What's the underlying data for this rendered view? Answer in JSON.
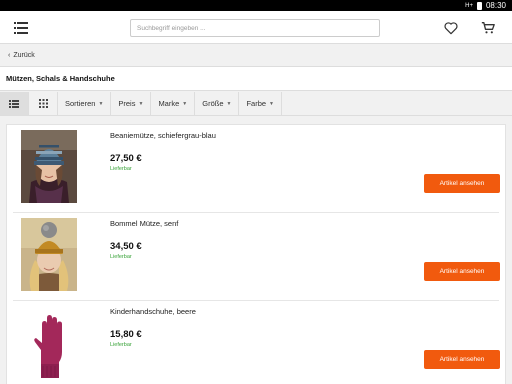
{
  "status_bar": {
    "signal": "H+",
    "time": "08:30"
  },
  "header": {
    "search_placeholder": "Suchbegriff eingeben ...",
    "icons": [
      "menu-icon",
      "heart-icon",
      "cart-icon"
    ]
  },
  "back": {
    "label": "Zurück"
  },
  "category": {
    "title": "Mützen, Schals & Handschuhe"
  },
  "filters": {
    "view_modes": [
      "list-view-icon",
      "grid-view-icon"
    ],
    "items": [
      {
        "label": "Sortieren"
      },
      {
        "label": "Preis"
      },
      {
        "label": "Marke"
      },
      {
        "label": "Größe"
      },
      {
        "label": "Farbe"
      }
    ]
  },
  "products": [
    {
      "name": "Beaniemütze, schiefergrau-blau",
      "price": "27,50 €",
      "availability": "Lieferbar",
      "button": "Artikel ansehen",
      "image": "person-wearing-striped-beanie"
    },
    {
      "name": "Bommel Mütze, senf",
      "price": "34,50 €",
      "availability": "Lieferbar",
      "button": "Artikel ansehen",
      "image": "person-wearing-mustard-bobble-hat"
    },
    {
      "name": "Kinderhandschuhe, beere",
      "price": "15,80 €",
      "availability": "Lieferbar",
      "button": "Artikel ansehen",
      "image": "berry-colored-glove"
    }
  ],
  "colors": {
    "accent": "#f15a0e",
    "available": "#3aa33a"
  }
}
